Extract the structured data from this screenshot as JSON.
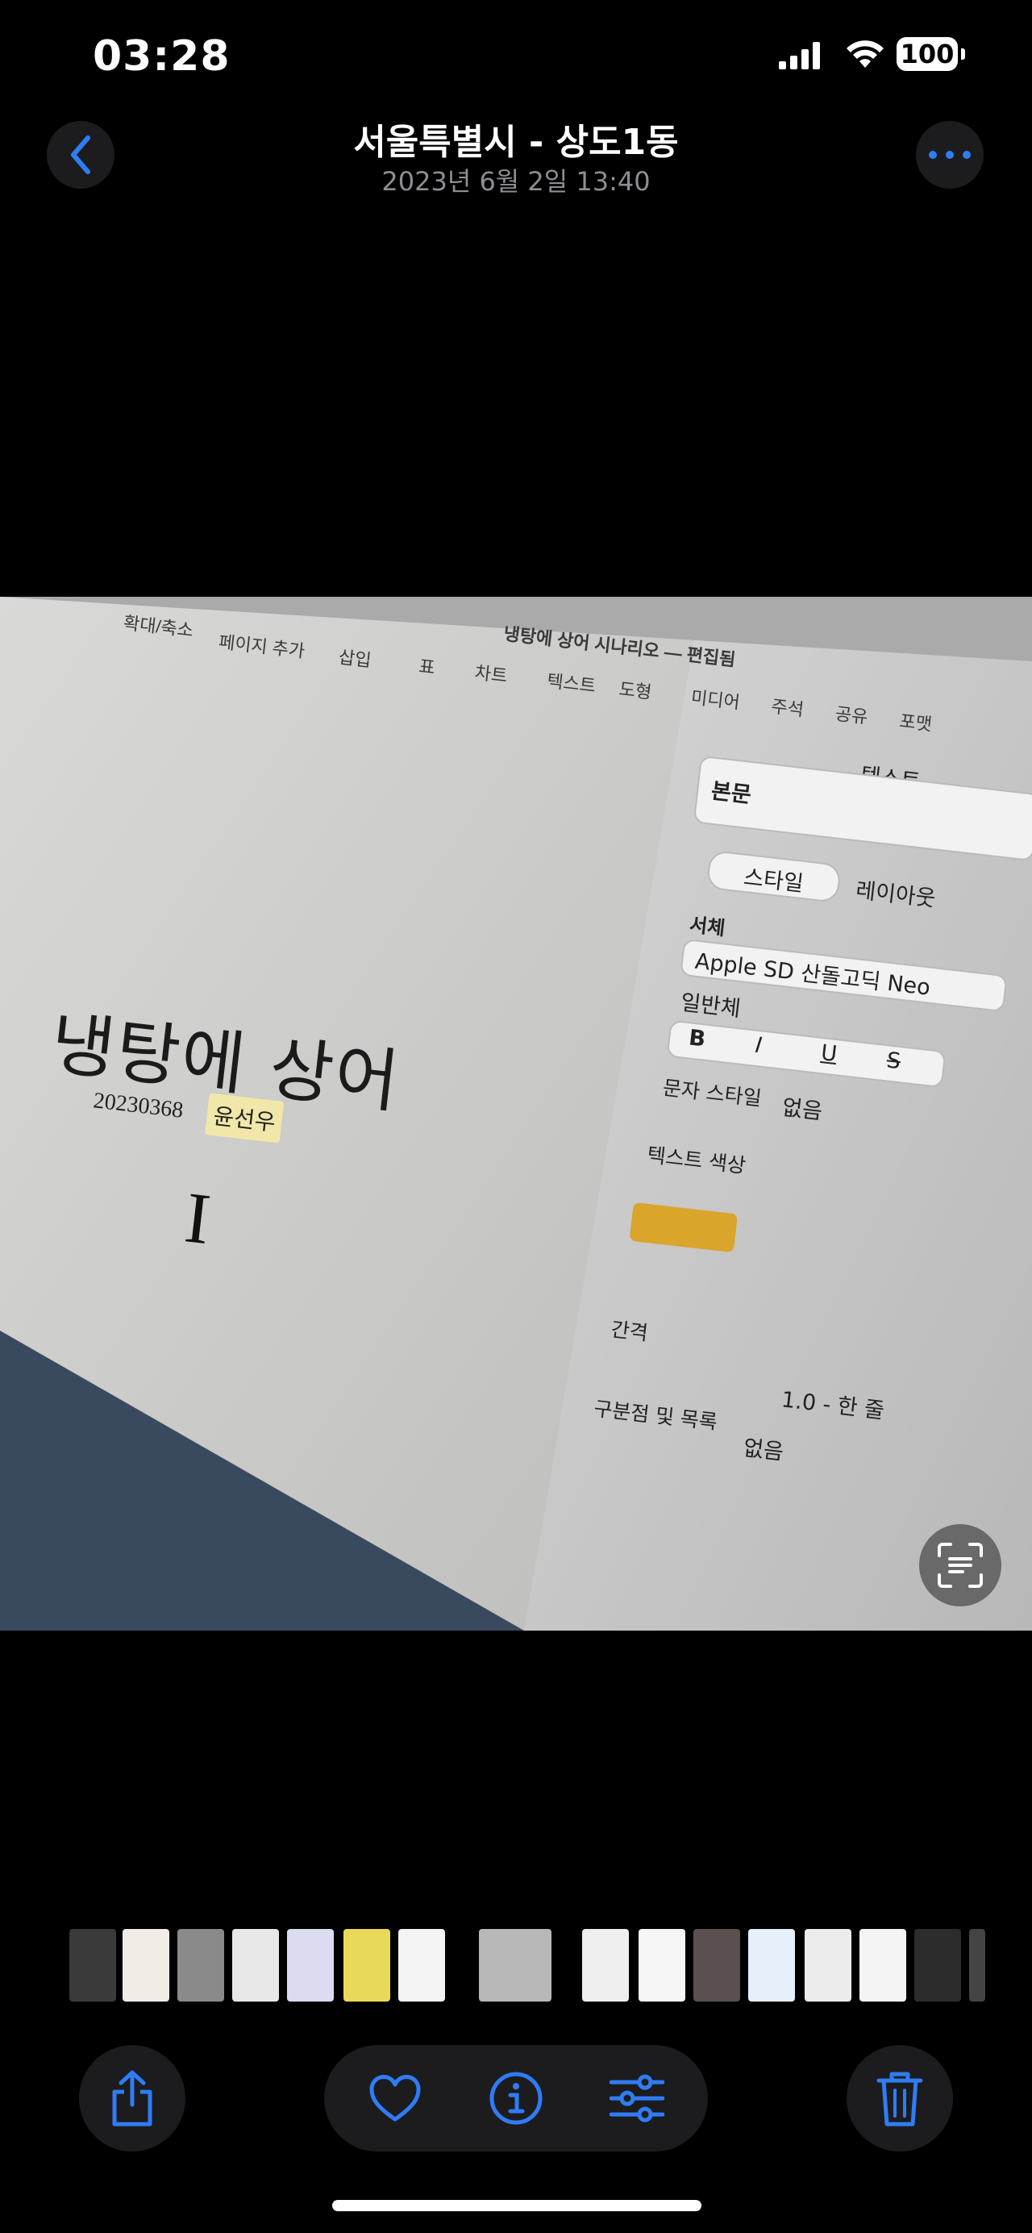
{
  "status_bar": {
    "time": "03:28",
    "battery": "100"
  },
  "header": {
    "title": "서울특별시 - 상도1동",
    "subtitle": "2023년 6월 2일  13:40"
  },
  "photo": {
    "window_title": "냉탕에 상어 시나리오 — 편집됨",
    "toolbar": [
      "확대/축소",
      "페이지 추가",
      "삽입",
      "표",
      "차트",
      "텍스트",
      "도형",
      "미디어",
      "주석",
      "공유",
      "포맷"
    ],
    "document": {
      "title": "냉탕에 상어",
      "student_id": "20230368",
      "name": "윤선우"
    },
    "panel": {
      "tab": "텍스트",
      "paragraph_style": "본문",
      "segments": [
        "스타일",
        "레이아웃"
      ],
      "font_label": "서체",
      "font_name": "Apple SD 산돌고딕 Neo",
      "font_weight": "일반체",
      "bold": "B",
      "italic": "I",
      "underline": "U",
      "strike": "S",
      "char_style_label": "문자 스타일",
      "char_style_value": "없음",
      "text_color_label": "텍스트 색상",
      "spacing_label": "간격",
      "spacing_value": "1.0 - 한 줄",
      "bullets_label": "구분점 및 목록",
      "bullets_value": "없음"
    }
  },
  "colors": {
    "accent": "#2f7cf6",
    "background": "#000000",
    "button_bg": "#1c1c1e"
  },
  "icons": {
    "back": "chevron-left-icon",
    "more": "ellipsis-icon",
    "share": "share-icon",
    "favorite": "heart-icon",
    "info": "info-icon",
    "adjust": "sliders-icon",
    "delete": "trash-icon",
    "live_text": "live-text-icon"
  }
}
